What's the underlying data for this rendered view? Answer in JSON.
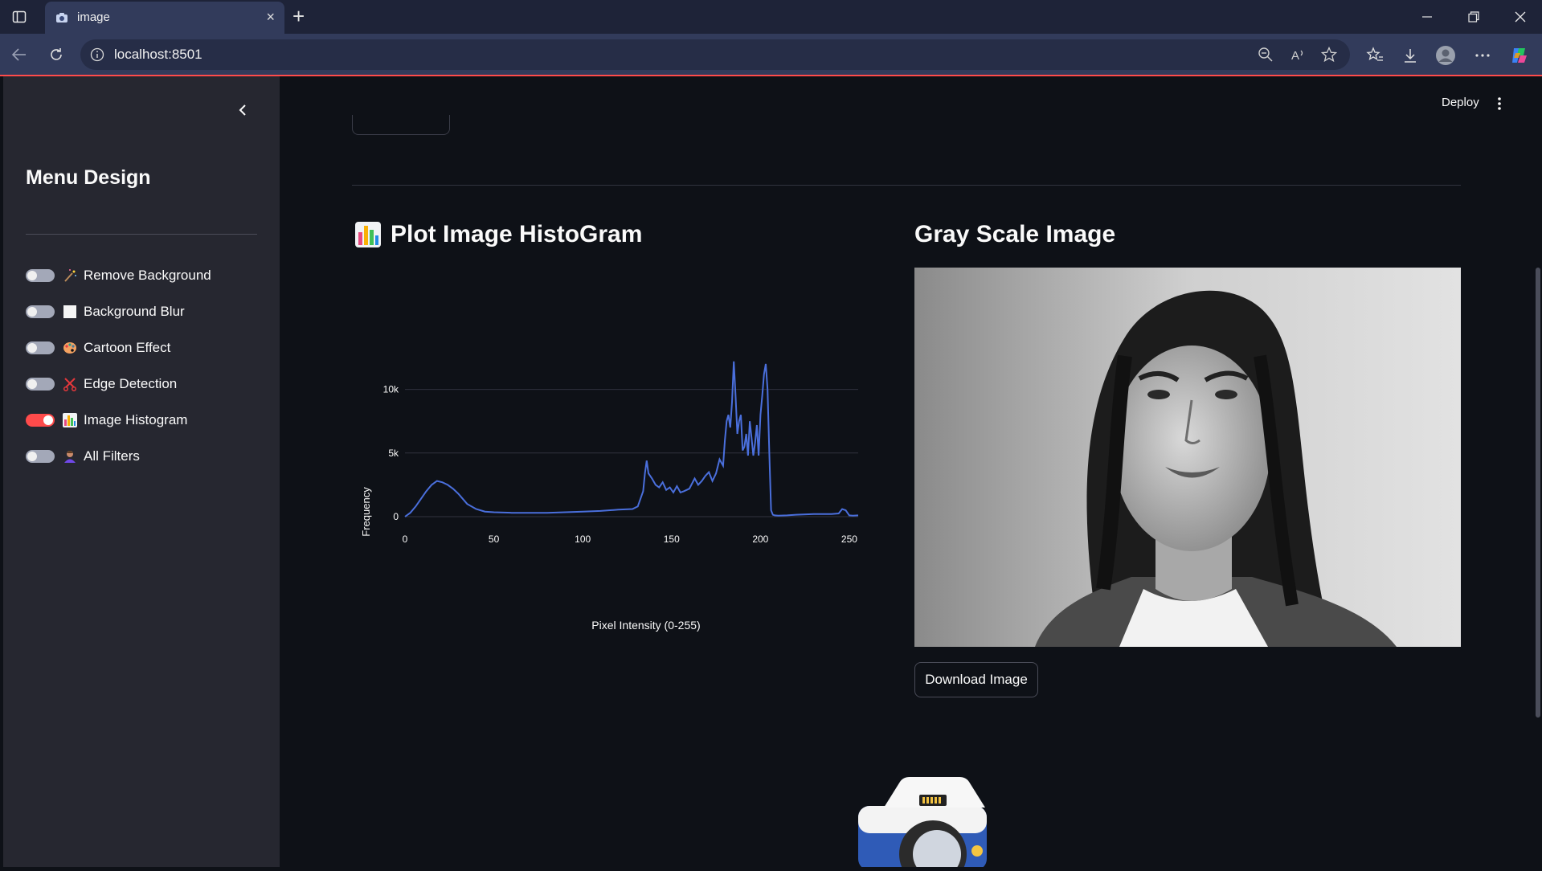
{
  "browser": {
    "tab_title": "image",
    "url": "localhost:8501",
    "new_tab_symbol": "+",
    "close_symbol": "×"
  },
  "sidebar": {
    "title": "Menu Design",
    "toggles": [
      {
        "label": "Remove Background",
        "on": false,
        "icon": "magic-wand-icon"
      },
      {
        "label": "Background Blur",
        "on": false,
        "icon": "white-square-icon"
      },
      {
        "label": "Cartoon Effect",
        "on": false,
        "icon": "palette-icon"
      },
      {
        "label": "Edge Detection",
        "on": false,
        "icon": "scissors-icon"
      },
      {
        "label": "Image Histogram",
        "on": true,
        "icon": "bar-chart-icon"
      },
      {
        "label": "All Filters",
        "on": false,
        "icon": "person-icon"
      }
    ]
  },
  "header": {
    "deploy_label": "Deploy"
  },
  "histogram": {
    "heading": "Plot Image HistoGram",
    "color": "#4a6fdc"
  },
  "gray": {
    "heading": "Gray Scale Image",
    "download_label": "Download Image"
  },
  "colors": {
    "accent": "#ff4b4b",
    "background": "#0e1117",
    "sidebar": "#262730"
  },
  "chart_data": {
    "type": "line",
    "title": "",
    "xlabel": "Pixel Intensity (0-255)",
    "ylabel": "Frequency",
    "xlim": [
      0,
      255
    ],
    "ylim": [
      0,
      12500
    ],
    "x_ticks": [
      "0",
      "50",
      "100",
      "150",
      "200",
      "250"
    ],
    "y_ticks": [
      "0",
      "5k",
      "10k"
    ],
    "grid": true,
    "series": [
      {
        "x": [
          0,
          3,
          6,
          9,
          12,
          15,
          18,
          21,
          24,
          27,
          30,
          35,
          40,
          45,
          50,
          60,
          70,
          80,
          90,
          100,
          110,
          120,
          128,
          131,
          134,
          135,
          136,
          137,
          139,
          141,
          143,
          145,
          147,
          149,
          151,
          153,
          155,
          157,
          160,
          163,
          165,
          167,
          169,
          171,
          173,
          175,
          177,
          179,
          180,
          181,
          182,
          183,
          184,
          185,
          186,
          187,
          188,
          189,
          190,
          191,
          192,
          193,
          194,
          195,
          196,
          197,
          198,
          199,
          200,
          201,
          202,
          203,
          204,
          205,
          206,
          207,
          208,
          210,
          215,
          220,
          230,
          240,
          244,
          246,
          248,
          250,
          252,
          255
        ],
        "y": [
          0,
          300,
          800,
          1400,
          2000,
          2500,
          2800,
          2700,
          2500,
          2200,
          1800,
          1000,
          600,
          400,
          350,
          300,
          300,
          300,
          350,
          400,
          450,
          550,
          600,
          800,
          2000,
          3400,
          4400,
          3400,
          3000,
          2500,
          2300,
          2700,
          2100,
          2300,
          1900,
          2400,
          1900,
          2000,
          2200,
          3000,
          2500,
          2800,
          3200,
          3500,
          2800,
          3400,
          4500,
          4000,
          6000,
          7500,
          8000,
          7000,
          9000,
          12200,
          9500,
          6500,
          7500,
          8000,
          5200,
          5500,
          6500,
          4800,
          7500,
          6200,
          4800,
          5800,
          7200,
          4800,
          8000,
          9500,
          11200,
          12000,
          10000,
          5000,
          500,
          150,
          100,
          80,
          100,
          150,
          200,
          200,
          250,
          600,
          500,
          100,
          80,
          100
        ]
      }
    ]
  }
}
